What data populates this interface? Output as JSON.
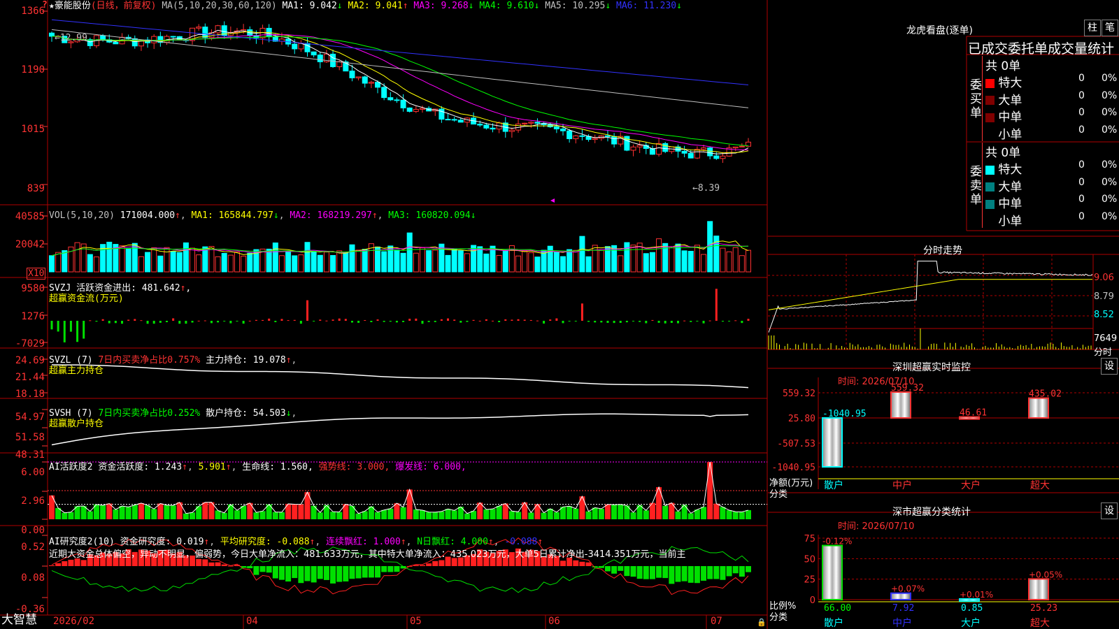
{
  "colors": {
    "up": "#ff3232",
    "down": "#00ffff",
    "grid": "#b00000",
    "ma1": "#ffffff",
    "ma2": "#ffff00",
    "ma3": "#ff00ff",
    "ma4": "#00ff00",
    "ma5": "#c0c0c0",
    "ma6": "#3232ff"
  },
  "kline": {
    "title": "★豪能股份",
    "mode": "(日线，前复权)",
    "ma_param": "MA(5,10,20,30,60,120)",
    "ma": [
      {
        "label": "MA1: 9.042",
        "arrow": "↓"
      },
      {
        "label": "MA2: 9.041",
        "arrow": "↑"
      },
      {
        "label": "MA3: 9.268",
        "arrow": "↓"
      },
      {
        "label": "MA4: 9.610",
        "arrow": "↓"
      },
      {
        "label": "MA5: 10.295",
        "arrow": "↓"
      },
      {
        "label": "MA6: 11.230",
        "arrow": "↓"
      }
    ],
    "y_labels": [
      "1366",
      "1190",
      "1015",
      "839"
    ],
    "high_label": "←12.99",
    "low_label": "←8.39",
    "top_marker": "?"
  },
  "vol": {
    "param": "VOL(5,10,20)",
    "value": "171004.000",
    "ma1": "MA1: 165844.797",
    "ma2": "MA2: 168219.297",
    "ma3": "MA3: 160820.094",
    "y_labels": [
      "40585",
      "20042"
    ],
    "unit": "X10"
  },
  "svzj": {
    "line1": "SVZJ  活跃资金进出: 481.642",
    "line2": "超赢资金流(万元)",
    "y_labels": [
      "9580",
      "1276",
      "-7029"
    ]
  },
  "svzl": {
    "name": "SVZL (7)",
    "desc": "7日内买卖净占比0.757%",
    "hold": "主力持仓: 19.078",
    "line2": "超赢主力持仓",
    "y_labels": [
      "24.69",
      "21.44",
      "18.18"
    ]
  },
  "svsh": {
    "name": "SVSH (7)",
    "desc": "7日内买卖净占比0.252%",
    "hold": "散户持仓: 54.503",
    "line2": "超赢散户持仓",
    "y_labels": [
      "54.97",
      "51.58",
      "48.31"
    ]
  },
  "ai1": {
    "name": "AI活跃度2",
    "a": "资金活跃度: 1.243",
    "b": "5.901",
    "c": "生命线: 1.560,",
    "d": "强势线: 3.000,",
    "e": "爆发线: 6.000,",
    "y_labels": [
      "6.00",
      "2.96",
      "0.00"
    ]
  },
  "ai2": {
    "name": "AI研究度2(10)",
    "a": "资金研究度: 0.019",
    "b": "平均研究度: -0.088",
    "c": "连续飘红: 1.000",
    "d": "N日飘红: 4.000",
    "e": "-0.088",
    "text": "近期大资金总体偏空，异动不明显，偏弱势，今日大单净流入：481.633万元，其中特大单净流入：435.023万元，大单5日累计净出-3414.351万元，当前主",
    "y_labels": [
      "0.52",
      "0.08",
      "-0.36"
    ]
  },
  "xaxis": {
    "labels": [
      "2026/02",
      "04",
      "05",
      "06",
      "07"
    ],
    "logo": "大智慧"
  },
  "dragon": {
    "title": "龙虎看盘(逐单)",
    "btn1": "柱",
    "btn2": "笔",
    "subtitle": "已成交委托单成交量统计",
    "buy": {
      "side": "委买单",
      "total": "共 0单",
      "rows": [
        {
          "name": "特大",
          "v": "0",
          "p": "0%",
          "c": "#ff0000"
        },
        {
          "name": "大单",
          "v": "0",
          "p": "0%",
          "c": "#800000"
        },
        {
          "name": "中单",
          "v": "0",
          "p": "0%",
          "c": "#800000"
        },
        {
          "name": "小单",
          "v": "0",
          "p": "0%",
          "c": ""
        }
      ]
    },
    "sell": {
      "side": "委卖单",
      "total": "共 0单",
      "rows": [
        {
          "name": "特大",
          "v": "0",
          "p": "0%",
          "c": "#00ffff"
        },
        {
          "name": "大单",
          "v": "0",
          "p": "0%",
          "c": "#008080"
        },
        {
          "name": "中单",
          "v": "0",
          "p": "0%",
          "c": "#008080"
        },
        {
          "name": "小单",
          "v": "0",
          "p": "0%",
          "c": ""
        }
      ]
    }
  },
  "minute": {
    "title": "分时走势",
    "y_labels": [
      "9.06",
      "8.79",
      "8.52"
    ],
    "vol_label": "7649",
    "vol_unit": "分时"
  },
  "monitor": {
    "title": "深圳超赢实时监控",
    "btn": "设",
    "time": "时间: 2026/07/10",
    "y_labels": [
      "559.32",
      "25.80",
      "-507.53",
      "-1040.95"
    ],
    "ylabel1": "净额(万元)",
    "ylabel2": "分类",
    "cats": [
      "散户",
      "中户",
      "大户",
      "超大"
    ],
    "values": [
      -1040.95,
      559.32,
      46.61,
      435.02
    ],
    "val_labels": [
      "-1040.95",
      "559.32",
      "46.61",
      "435.02"
    ]
  },
  "classify": {
    "title": "深市超赢分类统计",
    "btn": "设",
    "time": "时间: 2026/07/10",
    "y_labels": [
      "75",
      "50",
      "25",
      "0"
    ],
    "ylabel1": "比例%",
    "ylabel2": "分类",
    "cats": [
      "散户",
      "中户",
      "大户",
      "超大"
    ],
    "values": [
      66.0,
      7.92,
      0.85,
      25.23
    ],
    "val_labels": [
      "66.00",
      "7.92",
      "0.85",
      "25.23"
    ],
    "chg_labels": [
      "-0.12%",
      "+0.07%",
      "+0.01%",
      "+0.05%"
    ]
  }
}
